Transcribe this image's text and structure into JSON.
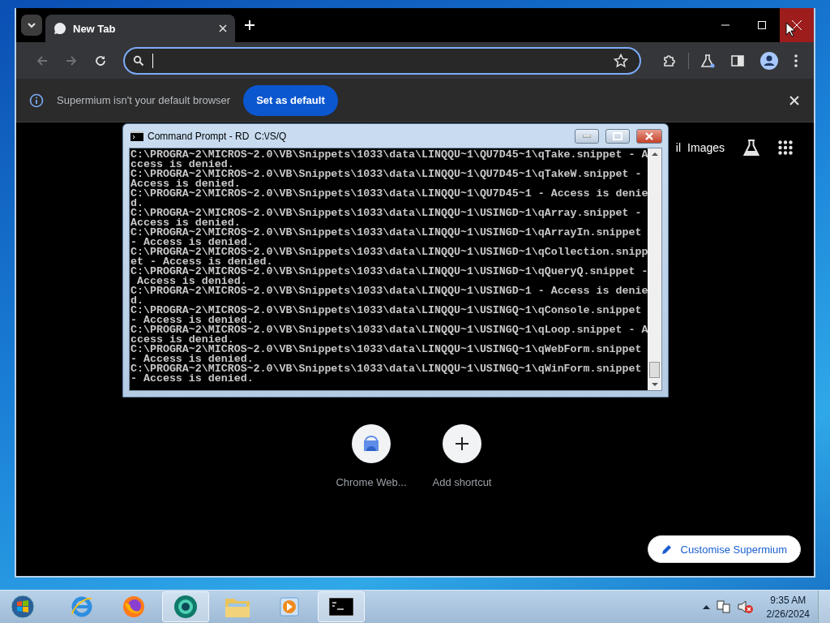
{
  "browser": {
    "tabs": [
      {
        "title": "New Tab",
        "selected": true
      }
    ],
    "nav": [
      {
        "kind": "back",
        "disabled": true
      },
      {
        "kind": "forward",
        "disabled": true
      },
      {
        "kind": "reload",
        "disabled": false
      }
    ],
    "infobar": {
      "message": "Supermium isn't your default browser",
      "button": "Set as default"
    },
    "new_tab_page": {
      "top_links": [
        "il",
        "Images"
      ],
      "shortcuts": [
        {
          "kind": "store",
          "label": "Chrome Web..."
        },
        {
          "kind": "add",
          "label": "Add shortcut"
        }
      ],
      "customise_button": "Customise Supermium"
    }
  },
  "console_window": {
    "title": "Command Prompt - RD  C:\\/S/Q",
    "lines": [
      "C:\\PROGRA~2\\MICROS~2.0\\VB\\Snippets\\1033\\data\\LINQQU~1\\QU7D45~1\\qTake.snippet - A",
      "ccess is denied.",
      "C:\\PROGRA~2\\MICROS~2.0\\VB\\Snippets\\1033\\data\\LINQQU~1\\QU7D45~1\\qTakeW.snippet -",
      "Access is denied.",
      "C:\\PROGRA~2\\MICROS~2.0\\VB\\Snippets\\1033\\data\\LINQQU~1\\QU7D45~1 - Access is denie",
      "d.",
      "C:\\PROGRA~2\\MICROS~2.0\\VB\\Snippets\\1033\\data\\LINQQU~1\\USINGD~1\\qArray.snippet -",
      "Access is denied.",
      "C:\\PROGRA~2\\MICROS~2.0\\VB\\Snippets\\1033\\data\\LINQQU~1\\USINGD~1\\qArrayIn.snippet",
      "- Access is denied.",
      "C:\\PROGRA~2\\MICROS~2.0\\VB\\Snippets\\1033\\data\\LINQQU~1\\USINGD~1\\qCollection.snipp",
      "et - Access is denied.",
      "C:\\PROGRA~2\\MICROS~2.0\\VB\\Snippets\\1033\\data\\LINQQU~1\\USINGD~1\\qQueryQ.snippet -",
      " Access is denied.",
      "C:\\PROGRA~2\\MICROS~2.0\\VB\\Snippets\\1033\\data\\LINQQU~1\\USINGD~1 - Access is denie",
      "d.",
      "C:\\PROGRA~2\\MICROS~2.0\\VB\\Snippets\\1033\\data\\LINQQU~1\\USINGQ~1\\qConsole.snippet",
      "- Access is denied.",
      "C:\\PROGRA~2\\MICROS~2.0\\VB\\Snippets\\1033\\data\\LINQQU~1\\USINGQ~1\\qLoop.snippet - A",
      "ccess is denied.",
      "C:\\PROGRA~2\\MICROS~2.0\\VB\\Snippets\\1033\\data\\LINQQU~1\\USINGQ~1\\qWebForm.snippet",
      "- Access is denied.",
      "C:\\PROGRA~2\\MICROS~2.0\\VB\\Snippets\\1033\\data\\LINQQU~1\\USINGQ~1\\qWinForm.snippet",
      "- Access is denied."
    ]
  },
  "taskbar": {
    "apps": [
      {
        "kind": "ie",
        "active": false
      },
      {
        "kind": "firefox",
        "active": false
      },
      {
        "kind": "supermium",
        "active": true
      },
      {
        "kind": "explorer",
        "active": false
      },
      {
        "kind": "media",
        "active": false
      },
      {
        "kind": "console",
        "active": true
      }
    ],
    "clock": {
      "time": "9:35 AM",
      "date": "2/26/2024"
    }
  }
}
